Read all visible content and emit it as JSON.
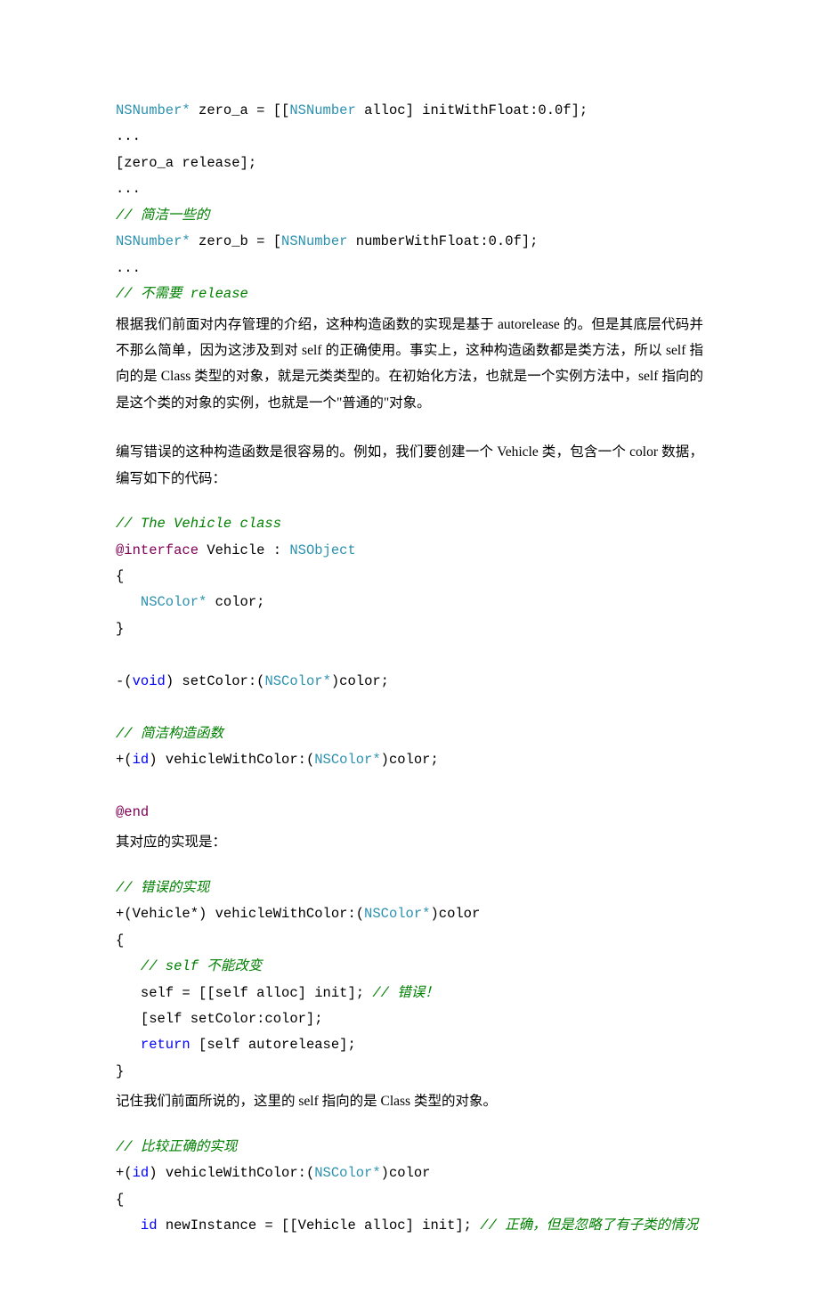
{
  "code1": {
    "l1": {
      "a": "NSNumber*",
      "b": " zero_a = [[",
      "c": "NSNumber",
      "d": " alloc] initWithFloat:0.0f];"
    },
    "l2": "...",
    "l3": "[zero_a release];",
    "l4": "...",
    "l5_cmt": "// 简洁一些的",
    "l6": {
      "a": "NSNumber*",
      "b": " zero_b = [",
      "c": "NSNumber",
      "d": " numberWithFloat:0.0f];"
    },
    "l7": "...",
    "l8_cmt": "// 不需要 release"
  },
  "para1": "根据我们前面对内存管理的介绍，这种构造函数的实现是基于 autorelease 的。但是其底层代码并不那么简单，因为这涉及到对 self 的正确使用。事实上，这种构造函数都是类方法，所以 self 指向的是 Class 类型的对象，就是元类类型的。在初始化方法，也就是一个实例方法中，self 指向的是这个类的对象的实例，也就是一个\"普通的\"对象。",
  "para2": "编写错误的这种构造函数是很容易的。例如，我们要创建一个 Vehicle 类，包含一个 color 数据，编写如下的代码：",
  "code2": {
    "l1_cmt": "// The Vehicle class",
    "l2": {
      "a": "@interface",
      "b": " Vehicle : ",
      "c": "NSObject"
    },
    "l3": "{",
    "l4": {
      "a": "   ",
      "b": "NSColor*",
      "c": " color;"
    },
    "l5": "}",
    "l7": {
      "a": "-(",
      "b": "void",
      "c": ") setColor:(",
      "d": "NSColor*",
      "e": ")color;"
    },
    "l9_cmt": "// 简洁构造函数",
    "l10": {
      "a": "+(",
      "b": "id",
      "c": ") vehicleWithColor:(",
      "d": "NSColor*",
      "e": ")color;"
    },
    "l12": "@end"
  },
  "para3": "其对应的实现是：",
  "code3": {
    "l1_cmt": "// 错误的实现",
    "l2": {
      "a": "+(Vehicle*) vehicleWithColor:(",
      "b": "NSColor*",
      "c": ")color"
    },
    "l3": "{",
    "l4_pad": "   ",
    "l4_cmt": "// self 不能改变",
    "l5": {
      "a": "   self = [[self alloc] init]; "
    },
    "l5_cmt": "// 错误！",
    "l6": "   [self setColor:color];",
    "l7": {
      "a": "   ",
      "b": "return",
      "c": " [self autorelease];"
    },
    "l8": "}"
  },
  "para4": "记住我们前面所说的，这里的 self 指向的是 Class 类型的对象。",
  "code4": {
    "l1_cmt": "// 比较正确的实现",
    "l2": {
      "a": "+(",
      "b": "id",
      "c": ") vehicleWithColor:(",
      "d": "NSColor*",
      "e": ")color"
    },
    "l3": "{",
    "l4_a": "   ",
    "l4_b": "id",
    "l4_c": " newInstance = [[Vehicle alloc] init]; ",
    "l4_cmt": "// 正确，但是忽略了有子类的情况"
  }
}
